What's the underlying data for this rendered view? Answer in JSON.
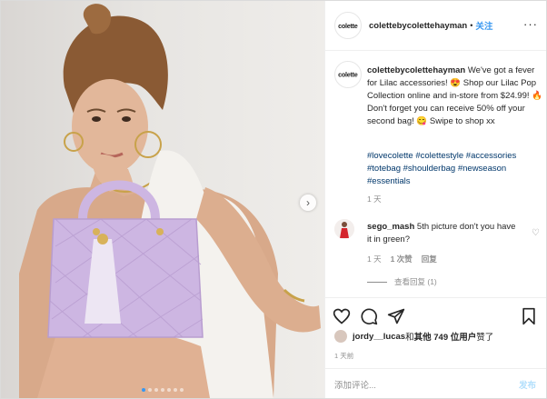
{
  "account": {
    "username": "colettebycolettehayman",
    "avatar_text": "colette",
    "separator": "•",
    "follow_label": "关注",
    "more_label": "···"
  },
  "caption": {
    "username": "colettebycolettehayman",
    "text": " We've got a fever for Lilac accessories! 😍 Shop our Lilac Pop Collection online and in-store from $24.99! 🔥 Don't forget you can receive 50% off your second bag! 😋 Swipe to shop xx",
    "hashtags": [
      "#lovecolette",
      "#colettestyle",
      "#accessories",
      "#totebag",
      "#shoulderbag",
      "#newseason",
      "#essentials"
    ],
    "time": "1 天"
  },
  "comment": {
    "username": "sego_mash",
    "text": " 5th picture don't you have it in green?",
    "time": "1 天",
    "likes": "1 次赞",
    "reply_label": "回复",
    "view_replies": "查看回复 (1)"
  },
  "likes": {
    "liker": "jordy__lucas",
    "middle": " 和 ",
    "others": "其他 749 位用户",
    "suffix": " 赞了"
  },
  "post_time": "1 天前",
  "add_comment": {
    "placeholder": "添加评论...",
    "post_label": "发布"
  },
  "carousel": {
    "slide_count": 7,
    "active_index": 0
  },
  "colors": {
    "link_blue": "#3897f0",
    "hashtag": "#00376b",
    "muted": "#8e8e8e",
    "bag_lilac": "#cdb6e2",
    "post_disabled": "#b2dffc"
  },
  "icons": [
    "heart-icon",
    "comment-icon",
    "share-icon",
    "bookmark-icon",
    "next-arrow-icon"
  ]
}
